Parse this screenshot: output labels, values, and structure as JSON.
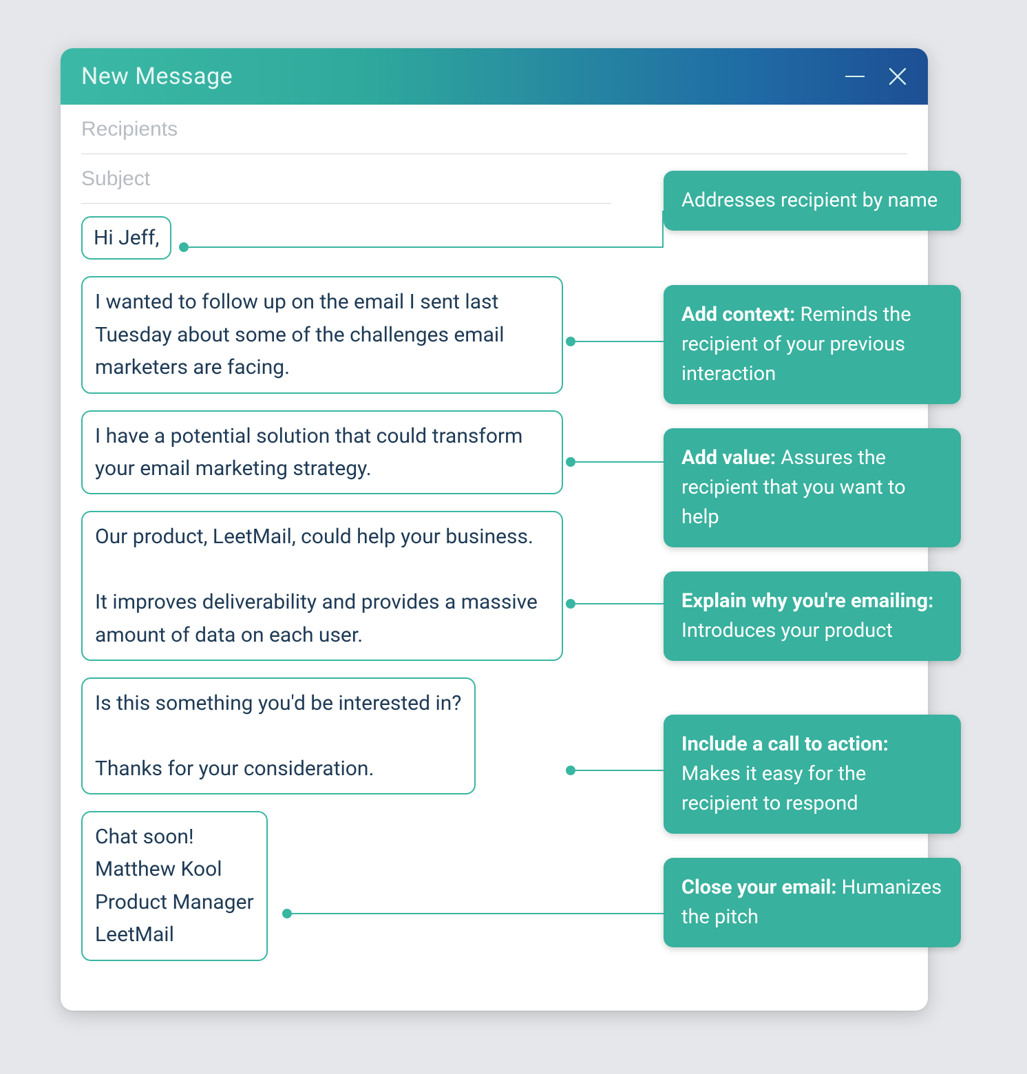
{
  "window": {
    "title": "New Message",
    "minimize_icon": "minimize",
    "close_icon": "close"
  },
  "fields": {
    "recipients_placeholder": "Recipients",
    "recipients_value": "",
    "subject_placeholder": "Subject",
    "subject_value": ""
  },
  "snippets": {
    "greeting": "Hi Jeff,",
    "context": "I wanted to follow up on the email I sent last Tuesday about some of the challenges email marketers are facing.",
    "value": "I have a potential solution that could transform  your email marketing strategy.",
    "explain": "Our product, LeetMail, could help your business.\n\nIt improves deliverability and provides a massive amount of data on each user.",
    "cta": "Is this something you'd be interested in?\n\nThanks for your consideration.",
    "close": "Chat soon!\nMatthew Kool\nProduct Manager\nLeetMail"
  },
  "callouts": {
    "greeting": {
      "bold": "",
      "text": "Addresses recipient by name"
    },
    "context": {
      "bold": "Add context:",
      "text": " Reminds the recipient of your previous interaction"
    },
    "value": {
      "bold": "Add value:",
      "text": " Assures the recipient that you want to help"
    },
    "explain": {
      "bold": "Explain why you're emailing:",
      "text": " Introduces your product"
    },
    "cta": {
      "bold": "Include a call to action:",
      "text": " Makes it easy for the recipient to respond"
    },
    "close": {
      "bold": "Close your email:",
      "text": " Humanizes the pitch"
    }
  },
  "colors": {
    "accent": "#39b6a1",
    "callout_bg": "#38b19e",
    "text": "#1e3a55"
  }
}
